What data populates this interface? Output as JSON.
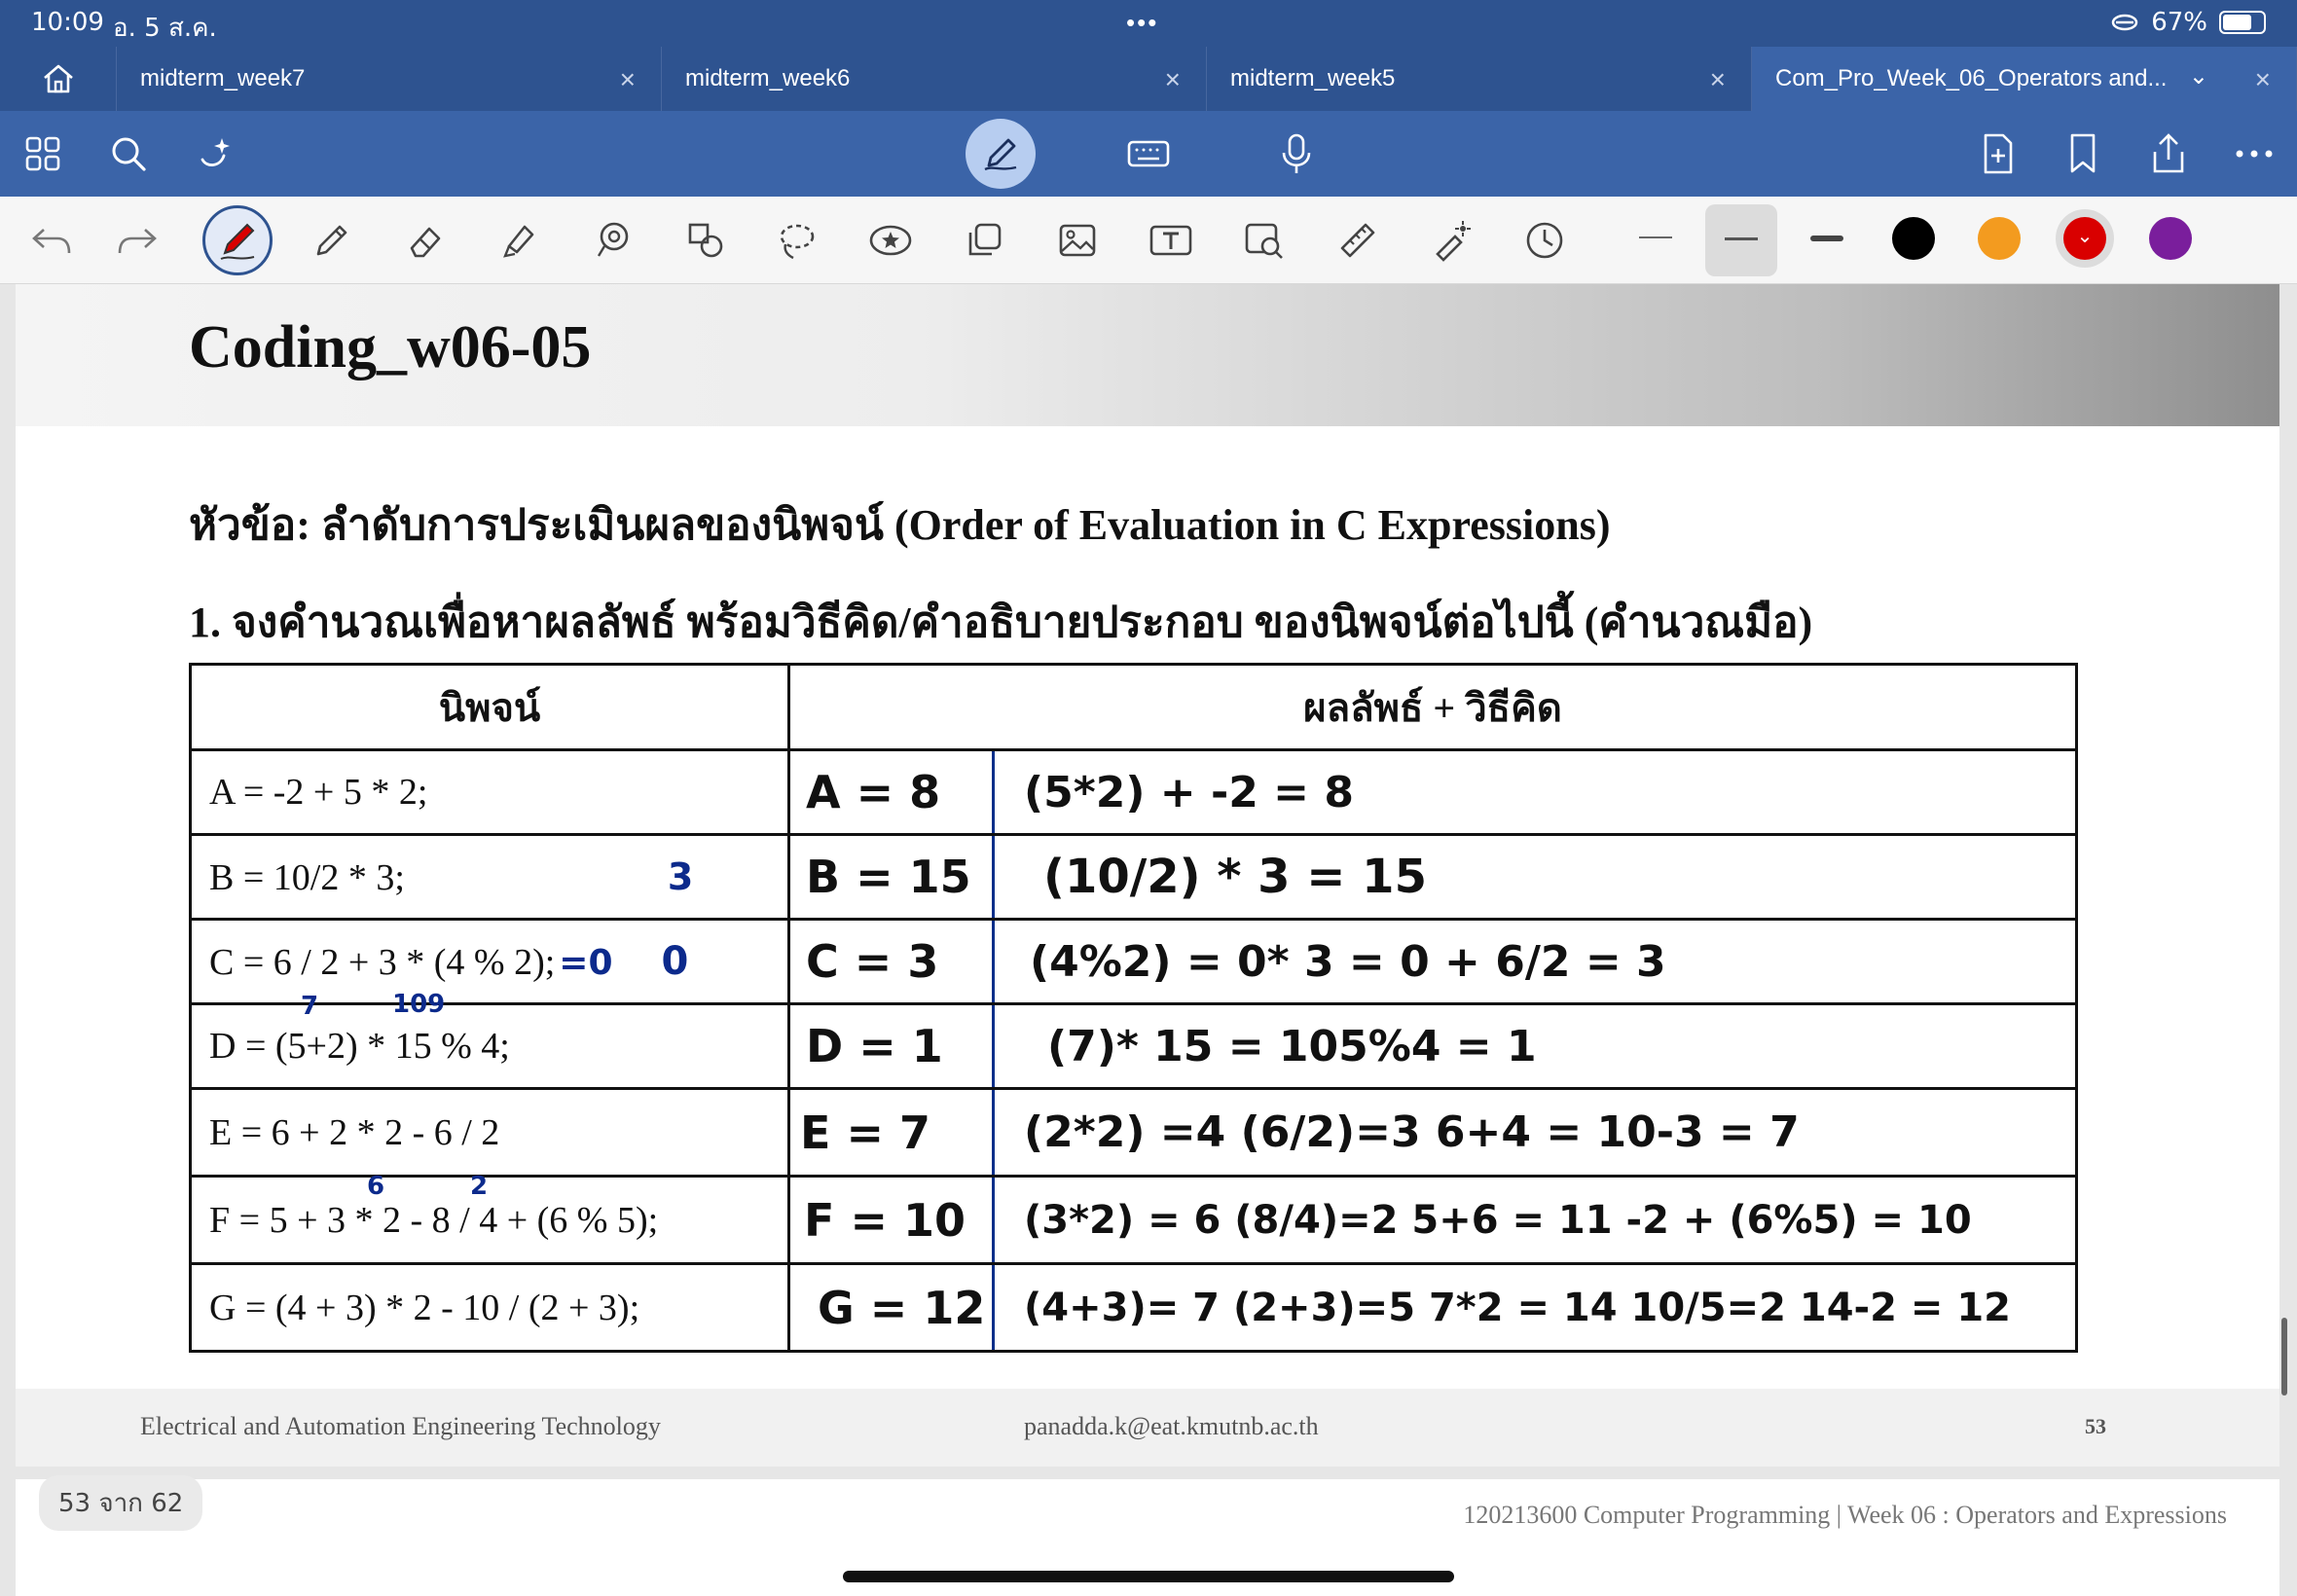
{
  "status": {
    "time": "10:09",
    "date": "อ. 5 ส.ค.",
    "dots": "•••",
    "battery": "67%"
  },
  "tabs": [
    {
      "label": "midterm_week7"
    },
    {
      "label": "midterm_week6"
    },
    {
      "label": "midterm_week5"
    },
    {
      "label": "Com_Pro_Week_06_Operators and..."
    }
  ],
  "colors": {
    "black": "#000000",
    "orange": "#f39b1f",
    "red": "#d90000",
    "purple": "#7a1e9c",
    "ink": "#0c2a8c"
  },
  "slide": {
    "title": "Coding_w06-05",
    "topic": "หัวข้อ: ลำดับการประเมินผลของนิพจน์ (Order of Evaluation in C Expressions)",
    "question": "1. จงคำนวณเพื่อหาผลลัพธ์ พร้อมวิธีคิด/คำอธิบายประกอบ ของนิพจน์ต่อไปนี้ (คำนวณมือ)",
    "header_expr": "นิพจน์",
    "header_result": "ผลลัพธ์ + วิธีคิด",
    "rows": [
      {
        "expr": "A = -2 + 5 * 2;",
        "answer": "A = 8",
        "work": "(5*2) + -2 = 8"
      },
      {
        "expr": "B = 10/2 * 3;",
        "answer": "B = 15",
        "work": "(10/2) * 3 = 15"
      },
      {
        "expr": "C = 6 / 2 + 3 * (4 % 2);",
        "answer": "C = 3",
        "work": "(4%2) = 0* 3 = 0 + 6/2 = 3"
      },
      {
        "expr": "D = (5+2) * 15 % 4;",
        "answer": "D = 1",
        "work": "(7)* 15 = 105%4 = 1"
      },
      {
        "expr": "E = 6 + 2 * 2 - 6 / 2",
        "answer": "E = 7",
        "work": "(2*2) =4  (6/2)=3   6+4 = 10-3 = 7"
      },
      {
        "expr": "F = 5 + 3 * 2 - 8 / 4 + (6 % 5);",
        "answer": "F = 10",
        "work": "(3*2) = 6  (8/4)=2  5+6 = 11 -2 + (6%5) = 10"
      },
      {
        "expr": "G = (4 + 3) * 2 - 10 / (2 + 3);",
        "answer": "G = 12",
        "work": "(4+3)= 7  (2+3)=5  7*2 = 14  10/5=2  14-2 = 12"
      }
    ],
    "margin_notes": {
      "b": "3",
      "c1": "=0",
      "c2": "0",
      "d1": "7",
      "d2": "109",
      "f1": "6",
      "f2": "2"
    },
    "footer_left": "Electrical and Automation Engineering Technology",
    "footer_center": "panadda.k@eat.kmutnb.ac.th",
    "footer_page": "53"
  },
  "page_indicator": "53 จาก 62",
  "course_footer": "120213600 Computer Programming | Week 06 : Operators and Expressions"
}
